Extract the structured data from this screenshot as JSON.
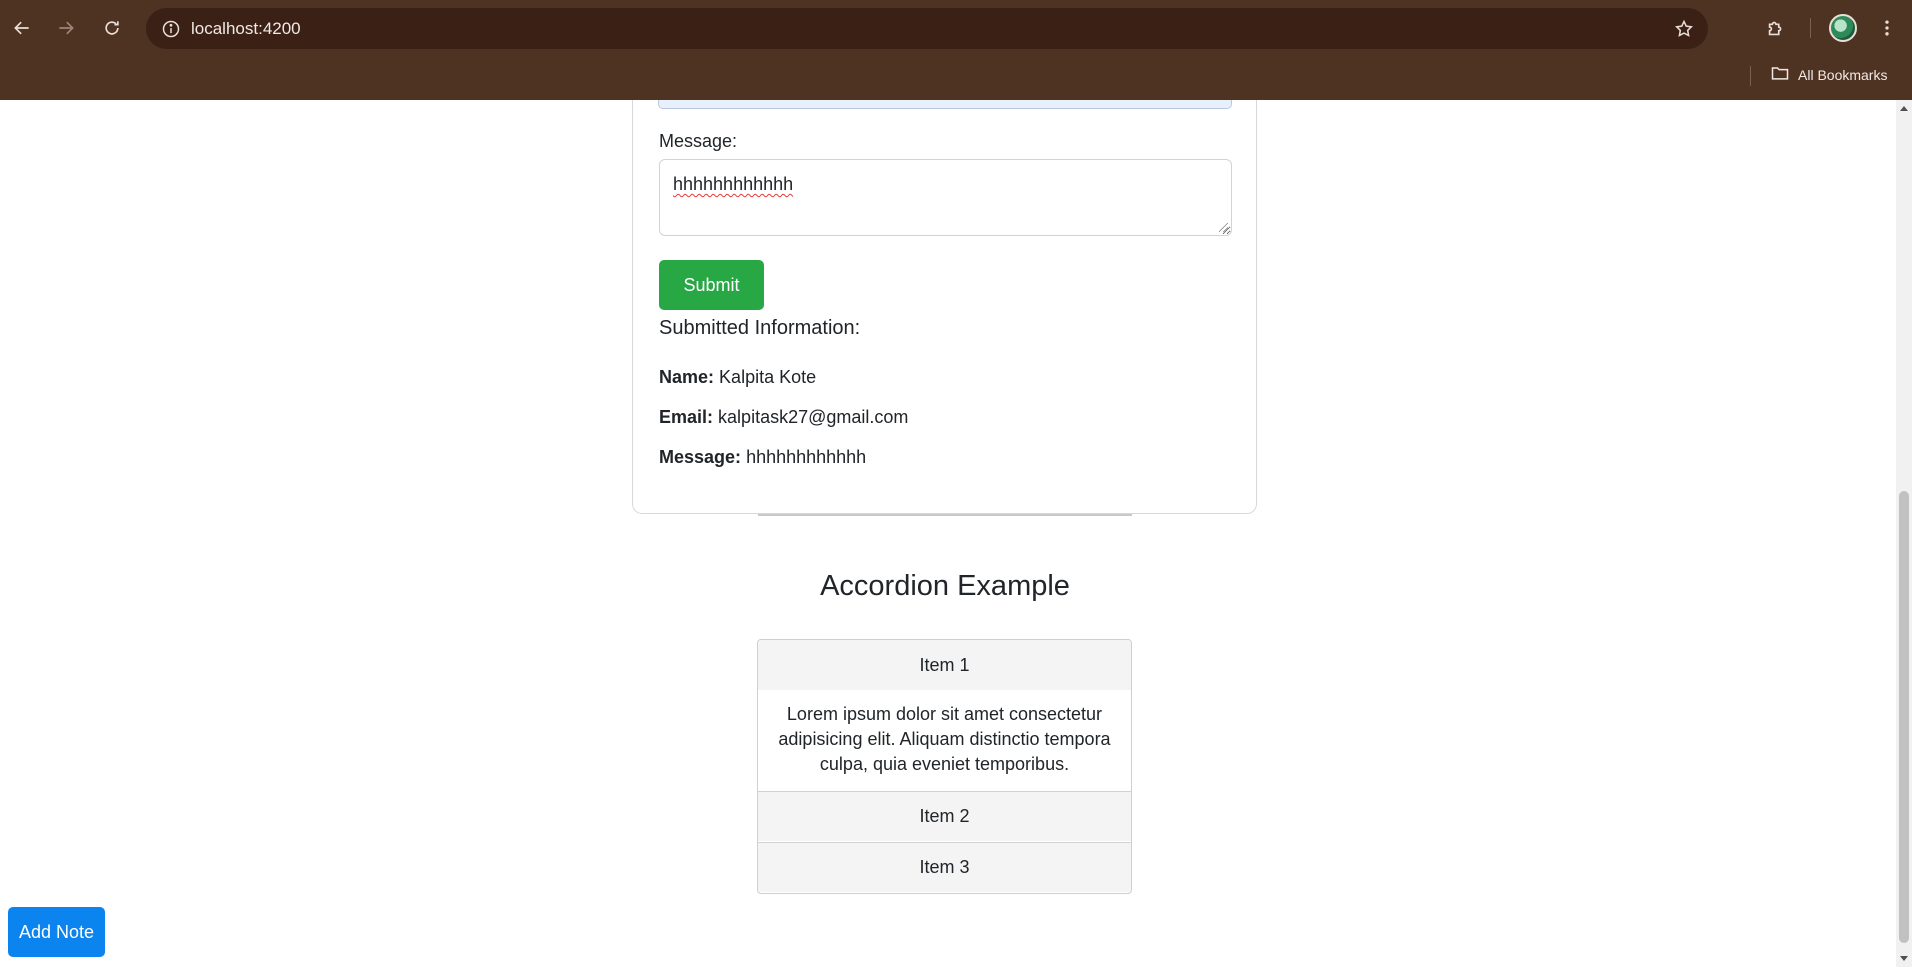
{
  "browser": {
    "url": "localhost:4200",
    "bookmarks_label": "All Bookmarks"
  },
  "form": {
    "message_label": "Message:",
    "message_value": "hhhhhhhhhhhh",
    "submit_label": "Submit"
  },
  "submitted": {
    "heading": "Submitted Information:",
    "name_label": "Name:",
    "name_value": "Kalpita Kote",
    "email_label": "Email:",
    "email_value": "kalpitask27@gmail.com",
    "message_label": "Message:",
    "message_value": "hhhhhhhhhhhh"
  },
  "accordion": {
    "title": "Accordion Example",
    "items": [
      {
        "label": "Item 1",
        "content": "Lorem ipsum dolor sit amet consectetur adipisicing elit. Aliquam distinctio tempora culpa, quia eveniet temporibus.",
        "expanded": true
      },
      {
        "label": "Item 2",
        "expanded": false
      },
      {
        "label": "Item 3",
        "expanded": false
      }
    ]
  },
  "add_note_label": "Add Note",
  "colors": {
    "chrome_bg": "#4f3322",
    "omnibox_bg": "#3b2016",
    "submit_green": "#28a745",
    "add_note_blue": "#0b84ef"
  }
}
